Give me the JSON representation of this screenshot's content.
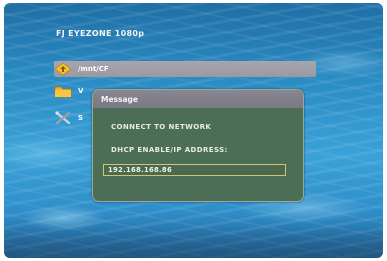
{
  "header": {
    "title": "FJ EYEZONE 1080p"
  },
  "file_list": {
    "items": [
      {
        "label": "/mnt/CF",
        "icon": "folder-up-diamond-icon",
        "selected": true
      },
      {
        "label": "V",
        "icon": "folder-icon",
        "selected": false
      },
      {
        "label": "S",
        "icon": "tools-icon",
        "selected": false
      }
    ]
  },
  "dialog": {
    "title": "Message",
    "line1": "CONNECT TO NETWORK",
    "line2": "DHCP ENABLE/IP ADDRESS:",
    "ip_value": "192.168.168.86"
  },
  "colors": {
    "dialog_bg": "#4d6e56",
    "header_bg": "#888690",
    "field_border": "#d3c56a",
    "selection_bg": "#a8a6ad"
  }
}
